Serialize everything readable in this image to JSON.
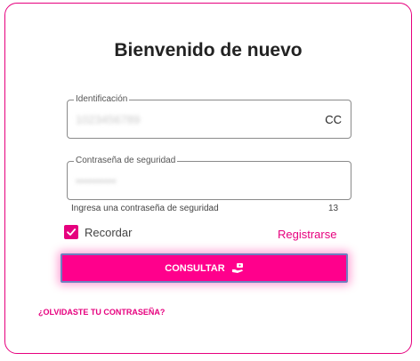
{
  "login": {
    "title": "Bienvenido de nuevo",
    "id_field": {
      "label": "Identificación",
      "value": "1023456789",
      "doc_type": "CC"
    },
    "password_field": {
      "label": "Contraseña de seguridad",
      "value": "••••••••••",
      "helper": "Ingresa una contraseña de seguridad",
      "counter": "13"
    },
    "remember_label": "Recordar",
    "register_label": "Registrarse",
    "submit_label": "CONSULTAR",
    "forgot_label": "¿OLVIDASTE TU CONTRASEÑA?"
  },
  "colors": {
    "accent": "#e6007e",
    "button_bg": "#ff008c",
    "button_border": "#6e7fbf"
  },
  "icons": {
    "submit": "hand-money-icon",
    "checkbox": "checkmark-icon"
  }
}
